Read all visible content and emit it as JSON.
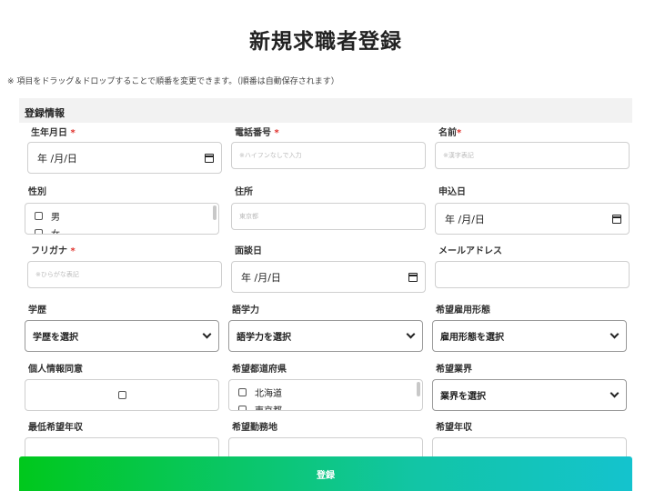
{
  "page": {
    "title": "新規求職者登録",
    "note": "※ 項目をドラッグ＆ドロップすることで順番を変更できます。（順番は自動保存されます）",
    "section_title": "登録情報",
    "required_mark": "*"
  },
  "fields": {
    "birthdate": {
      "label": "生年月日",
      "value": "年 /月/日",
      "required": true
    },
    "phone": {
      "label": "電話番号",
      "placeholder": "※ハイフンなしで入力",
      "required": true
    },
    "name": {
      "label": "名前",
      "placeholder": "※漢字表記",
      "required": true
    },
    "gender": {
      "label": "性別",
      "options": [
        "男",
        "女"
      ]
    },
    "address": {
      "label": "住所",
      "placeholder": "東京都"
    },
    "apply_date": {
      "label": "申込日",
      "value": "年 /月/日"
    },
    "furigana": {
      "label": "フリガナ",
      "placeholder": "※ひらがな表記",
      "required": true
    },
    "interview_date": {
      "label": "面談日",
      "value": "年 /月/日"
    },
    "email": {
      "label": "メールアドレス"
    },
    "education": {
      "label": "学歴",
      "value": "学歴を選択"
    },
    "language": {
      "label": "語学力",
      "value": "語学力を選択"
    },
    "employment_type": {
      "label": "希望雇用形態",
      "value": "雇用形態を選択"
    },
    "privacy_consent": {
      "label": "個人情報同意"
    },
    "prefecture": {
      "label": "希望都道府県",
      "options": [
        "北海道",
        "東京都"
      ]
    },
    "industry": {
      "label": "希望業界",
      "value": "業界を選択"
    },
    "min_salary": {
      "label": "最低希望年収"
    },
    "work_location": {
      "label": "希望勤務地"
    },
    "salary": {
      "label": "希望年収"
    }
  },
  "submit": {
    "label": "登録"
  },
  "icons": {
    "date": "calendar-icon",
    "select": "chevron-down-icon",
    "check": "checkbox"
  },
  "colors": {
    "required": "#e0312c",
    "button_start": "#00c81c",
    "button_end": "#14c3ce",
    "section_bg": "#f2f2f2"
  }
}
